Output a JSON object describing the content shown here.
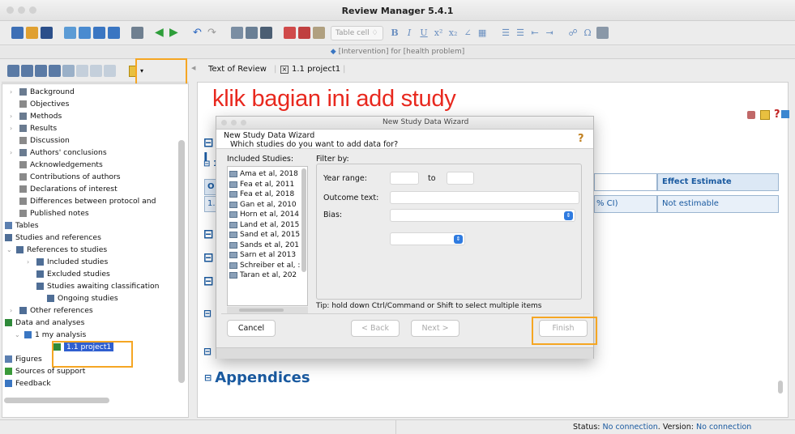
{
  "window": {
    "title": "Review Manager 5.4.1"
  },
  "toolbar": {
    "table_cell_label": "Table cell ♢"
  },
  "doc_bar": {
    "title": "[Intervention] for [health problem]"
  },
  "tree": {
    "items": [
      "Background",
      "Objectives",
      "Methods",
      "Results",
      "Discussion",
      "Authors' conclusions",
      "Acknowledgements",
      "Contributions of authors",
      "Declarations of interest",
      "Differences between protocol and",
      "Published notes",
      "Tables",
      "Studies and references",
      "References to studies",
      "Included studies",
      "Excluded studies",
      "Studies awaiting classification",
      "Ongoing studies",
      "Other references",
      "Data and analyses",
      "1 my analysis",
      "1.1 project1",
      "Figures",
      "Sources of support",
      "Feedback"
    ]
  },
  "tabs": {
    "text_of_review": "Text of Review",
    "project_tab": "1.1 project1"
  },
  "annotation": {
    "text": "klik bagian ini add study"
  },
  "table": {
    "col_effect": "Effect Estimate",
    "cell_ci": "% CI)",
    "cell_effect": "Not estimable",
    "col_o": "O",
    "row_1": "1."
  },
  "headings": {
    "appendices": "Appendices"
  },
  "dialog": {
    "window_title": "New Study Data Wizard",
    "heading": "New Study Data Wizard",
    "question": "Which studies do you want to add data for?",
    "included_label": "Included Studies:",
    "filter_label": "Filter by:",
    "year_range_label": "Year range:",
    "to_label": "to",
    "outcome_label": "Outcome text:",
    "bias_label": "Bias:",
    "tip": "Tip: hold down Ctrl/Command or Shift to select multiple items",
    "cancel": "Cancel",
    "back": "< Back",
    "next": "Next >",
    "finish": "Finish",
    "studies": [
      "Ama et al, 2018",
      "Fea et al, 2011",
      "Fea et al, 2018",
      "Gan et al, 2010",
      "Horn et al, 2014",
      "Land et al, 2015",
      "Sand et al, 2015",
      "Sands et al, 201",
      "Sarn et al 2013",
      "Schreiber et al, :",
      "Taran et al, 202"
    ]
  },
  "status": {
    "label": "Status:",
    "value": "No connection",
    "version_label": ". Version:",
    "version_value": "No connection"
  },
  "colors": {
    "accent": "#1a5aa0",
    "highlight": "#f5a623",
    "annotation": "#e8281e",
    "selection": "#2f5fd0"
  }
}
